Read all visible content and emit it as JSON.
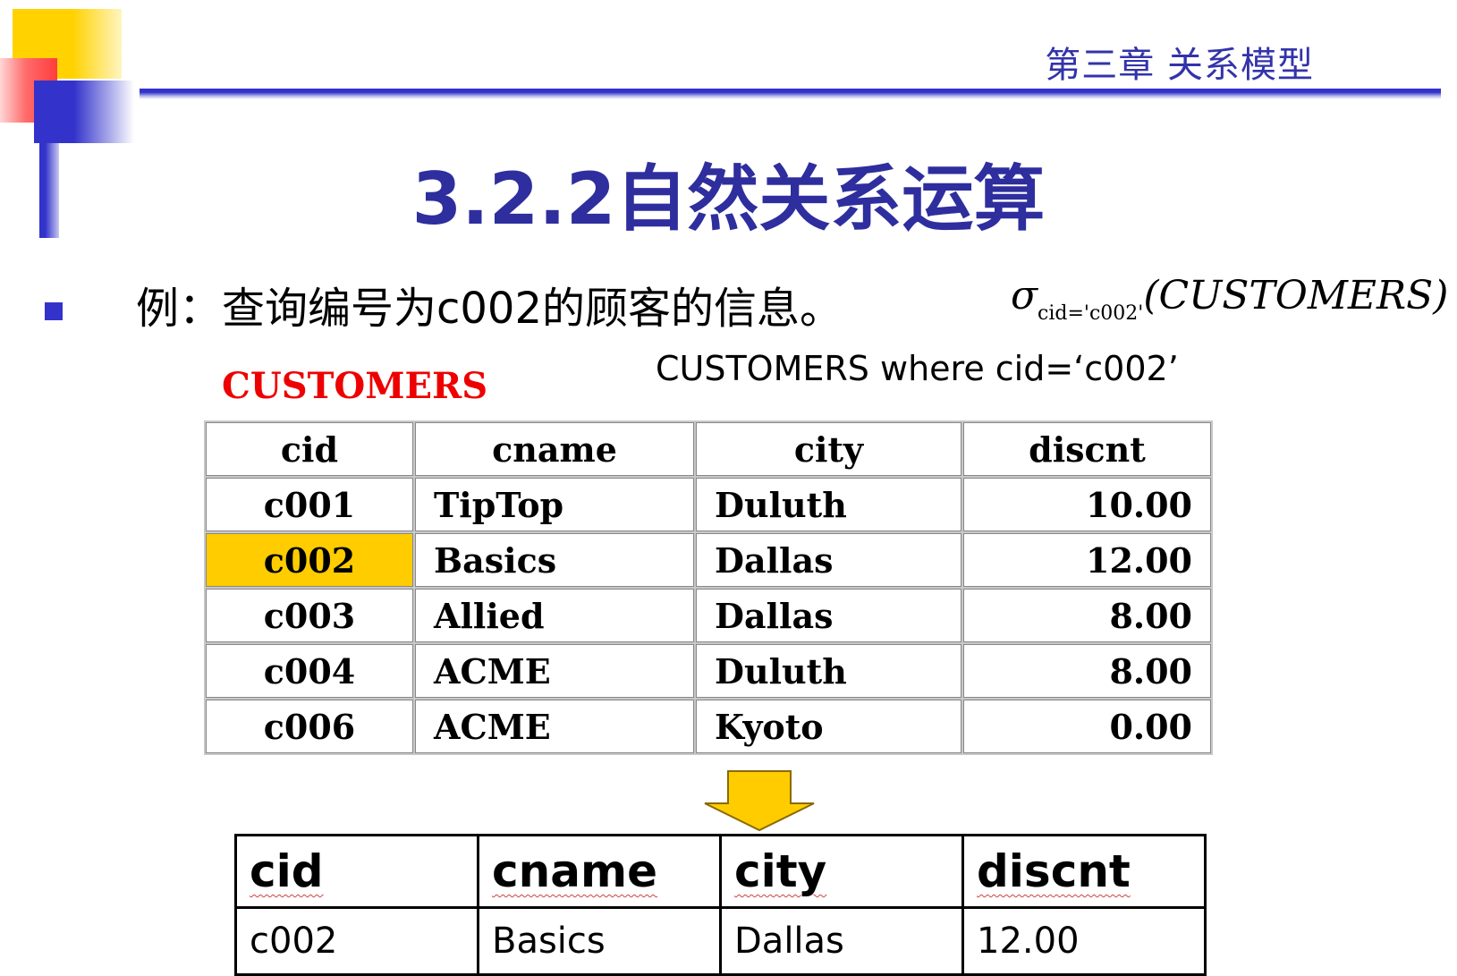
{
  "header": {
    "chapter": "第三章 关系模型"
  },
  "title": "3.2.2自然关系运算",
  "example": {
    "text": "例：查询编号为c002的顾客的信息。",
    "sigma_symbol": "σ",
    "sigma_subscript": "cid='c002'",
    "sigma_argument": "(CUSTOMERS)",
    "where_clause": "CUSTOMERS where cid=‘c002’"
  },
  "customers_table": {
    "name": "CUSTOMERS",
    "columns": [
      "cid",
      "cname",
      "city",
      "discnt"
    ],
    "rows": [
      [
        "c001",
        "TipTop",
        "Duluth",
        "10.00"
      ],
      [
        "c002",
        "Basics",
        "Dallas",
        "12.00"
      ],
      [
        "c003",
        "Allied",
        "Dallas",
        "8.00"
      ],
      [
        "c004",
        "ACME",
        "Duluth",
        "8.00"
      ],
      [
        "c006",
        "ACME",
        "Kyoto",
        "0.00"
      ]
    ],
    "highlight_color": "#ffcc00"
  },
  "result_table": {
    "columns": [
      "cid",
      "cname",
      "city",
      "discnt"
    ],
    "rows": [
      [
        "c002",
        "Basics",
        "Dallas",
        "12.00"
      ]
    ]
  },
  "colors": {
    "accent_blue": "#3333cc",
    "title_blue": "#2e2e9e",
    "table_name_red": "#ee0000",
    "arrow_yellow": "#ffcc00"
  },
  "icons": {
    "bullet": "square-bullet-icon",
    "arrow": "down-arrow-icon"
  }
}
